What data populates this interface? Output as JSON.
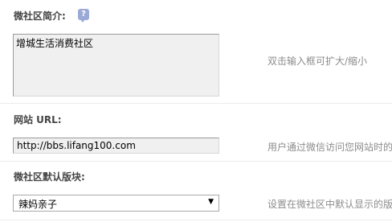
{
  "intro": {
    "label": "微社区简介:",
    "value": "增城生活消费社区",
    "hint": "双击输入框可扩大/缩小",
    "help_icon": "question-bubble-icon"
  },
  "website": {
    "label": "网站 URL:",
    "value": "http://bbs.lifang100.com",
    "hint": "用户通过微信访问您网站时的"
  },
  "default_board": {
    "label": "微社区默认版块:",
    "selected": "辣妈亲子",
    "hint": "设置在微社区中默认显示的版"
  }
}
